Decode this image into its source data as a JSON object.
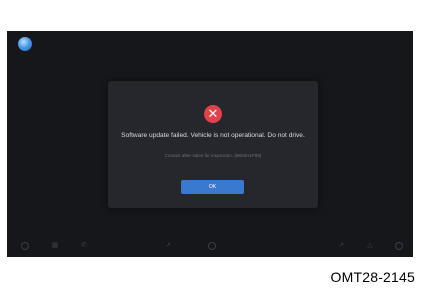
{
  "status_bar": {
    "app_icon": "blue-orb-icon"
  },
  "dialog": {
    "icon": "close-x-icon",
    "icon_color": "#e0424c",
    "message": "Software update failed. Vehicle is not operational. Do not drive.",
    "submessage": "Contact after-sales for inspection. (9602H1F69)",
    "ok_label": "OK",
    "ok_color": "#3b78d0"
  },
  "dock": {
    "icons": [
      "home-icon",
      "media-icon",
      "phone-icon",
      "arrow-icon",
      "settings-icon",
      "navigation-icon",
      "map-icon",
      "profile-icon"
    ]
  },
  "caption": "OMT28-2145"
}
